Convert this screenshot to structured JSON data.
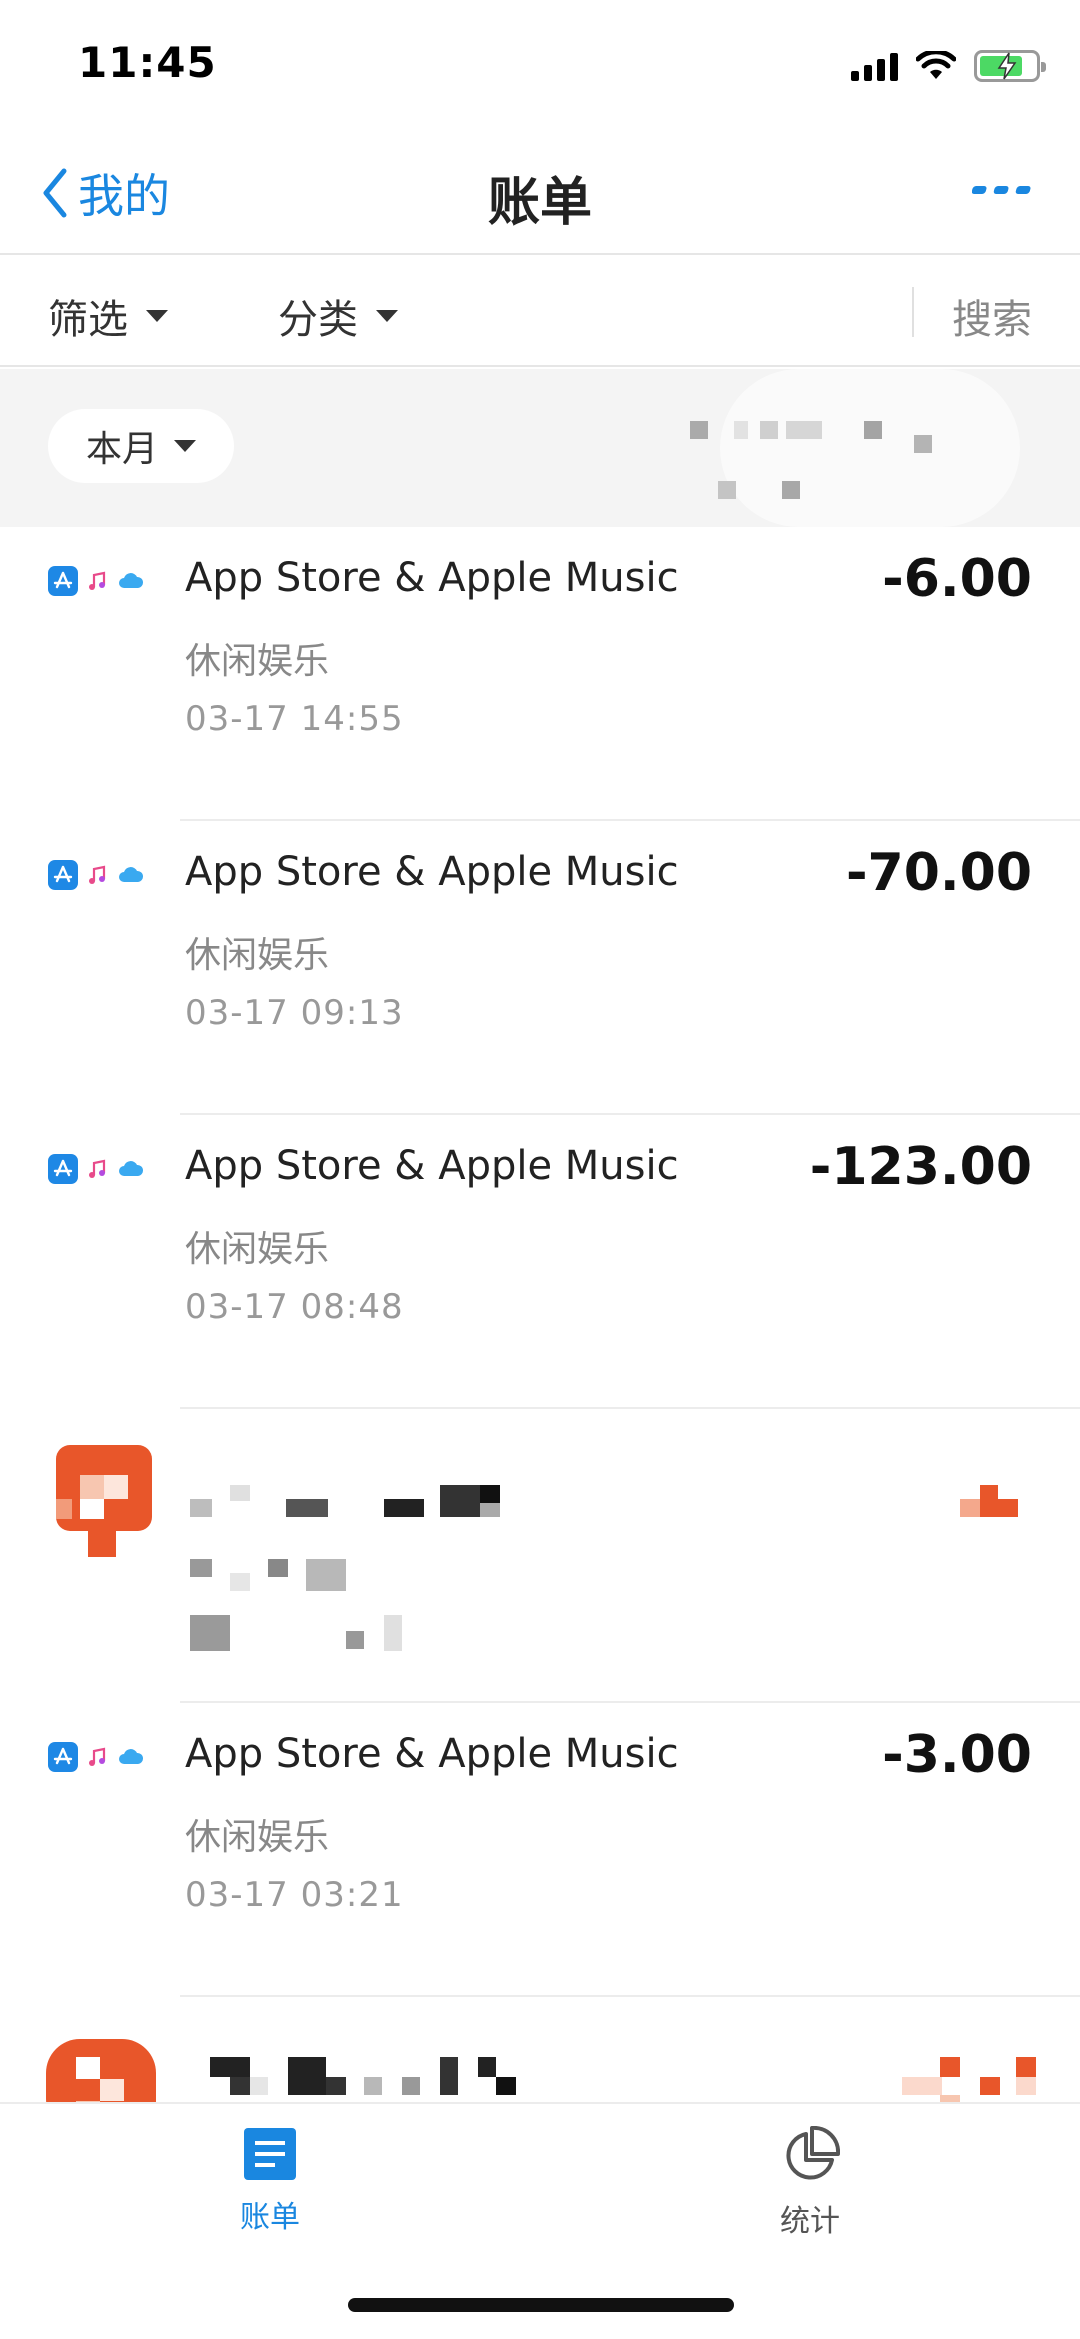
{
  "status_bar": {
    "time": "11:45"
  },
  "nav": {
    "back_label": "我的",
    "title": "账单"
  },
  "filters": {
    "filter_label": "筛选",
    "category_label": "分类",
    "search_label": "搜索"
  },
  "month": {
    "label": "本月"
  },
  "transactions": [
    {
      "title": "App Store & Apple Music",
      "category": "休闲娱乐",
      "time": "03-17  14:55",
      "amount": "-6.00"
    },
    {
      "title": "App Store & Apple Music",
      "category": "休闲娱乐",
      "time": "03-17  09:13",
      "amount": "-70.00"
    },
    {
      "title": "App Store & Apple Music",
      "category": "休闲娱乐",
      "time": "03-17  08:48",
      "amount": "-123.00"
    },
    {
      "title": "App Store & Apple Music",
      "category": "休闲娱乐",
      "time": "03-17  03:21",
      "amount": "-3.00"
    }
  ],
  "tabs": [
    {
      "label": "账单",
      "active": true
    },
    {
      "label": "统计",
      "active": false
    }
  ],
  "colors": {
    "accent": "#1a87e0",
    "redacted_logo": "#e8562a",
    "month_bar_bg": "#f4f4f4"
  }
}
